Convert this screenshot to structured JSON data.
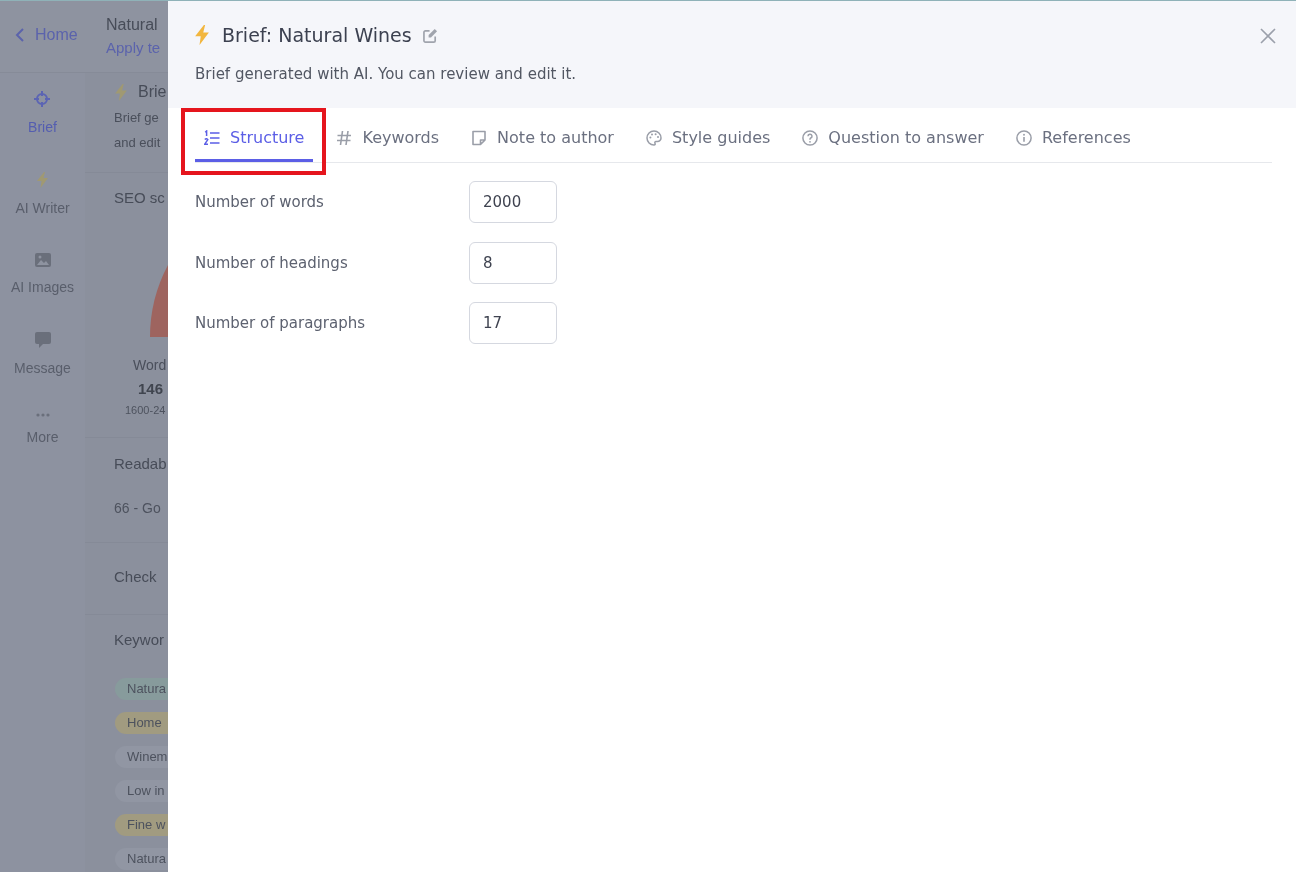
{
  "background_app": {
    "back_link": "Home",
    "title": "Natural",
    "apply_link": "Apply te",
    "nav": [
      {
        "label": "Brief",
        "selected": true
      },
      {
        "label": "AI Writer",
        "selected": false
      },
      {
        "label": "AI Images",
        "selected": false
      },
      {
        "label": "Message",
        "selected": false
      },
      {
        "label": "More",
        "selected": false
      }
    ],
    "brief": {
      "heading": "Brie",
      "lines": [
        "Brief ge",
        "and edit"
      ]
    },
    "seo_score": {
      "heading": "SEO sc",
      "words_label": "Word",
      "words_value": "146",
      "words_range": "1600-24"
    },
    "readability": {
      "heading": "Readab",
      "score": "66 - Go"
    },
    "check": {
      "heading": "Check"
    },
    "keywords": {
      "heading": "Keywor",
      "chips": [
        {
          "text": "Natura",
          "color": "#879b9c"
        },
        {
          "text": "Home",
          "color": "#a19b80"
        },
        {
          "text": "Winem",
          "color": "#9196a3"
        },
        {
          "text": "Low in",
          "color": "#9196a3"
        },
        {
          "text": "Fine w",
          "color": "#a19b80"
        },
        {
          "text": "Natura",
          "color": "#9196a3"
        }
      ]
    }
  },
  "drawer": {
    "title": "Brief: Natural Wines",
    "subtitle": "Brief generated with AI. You can review and edit it.",
    "tabs": [
      {
        "label": "Structure",
        "selected": true,
        "highlighted": true
      },
      {
        "label": "Keywords",
        "selected": false,
        "highlighted": false
      },
      {
        "label": "Note to author",
        "selected": false,
        "highlighted": false
      },
      {
        "label": "Style guides",
        "selected": false,
        "highlighted": false
      },
      {
        "label": "Question to answer",
        "selected": false,
        "highlighted": false
      },
      {
        "label": "References",
        "selected": false,
        "highlighted": false
      }
    ],
    "fields": [
      {
        "label": "Number of words",
        "value": "2000"
      },
      {
        "label": "Number of headings",
        "value": "8"
      },
      {
        "label": "Number of paragraphs",
        "value": "17"
      }
    ]
  }
}
